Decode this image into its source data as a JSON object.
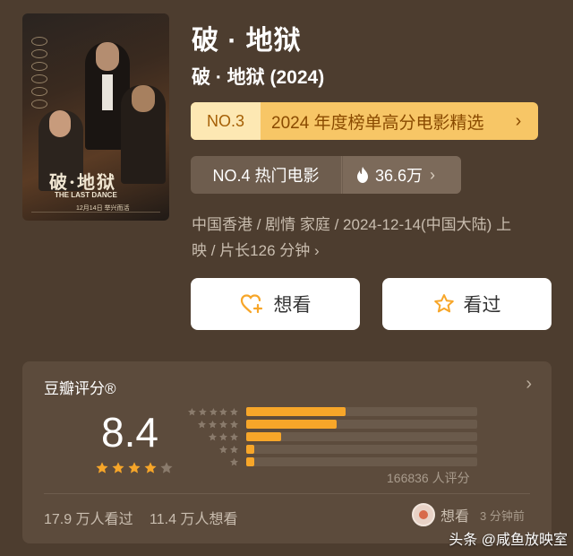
{
  "movie": {
    "title": "破 · 地狱",
    "subtitle": "破 · 地狱 (2024)"
  },
  "poster": {
    "title_art": "破·地狱",
    "title_en": "THE LAST DANCE",
    "release_text": "12月14日 举兴而活"
  },
  "ranking": {
    "rank_no": "NO.3",
    "rank_label": "2024 年度榜单高分电影精选"
  },
  "hot": {
    "hot_label": "NO.4 热门电影",
    "heat_value": "36.6万"
  },
  "meta": {
    "line1": "中国香港 / 剧情 家庭 / 2024-12-14(中国大陆) 上",
    "line2": "映 / 片长126 分钟"
  },
  "actions": {
    "want_label": "想看",
    "seen_label": "看过"
  },
  "rating": {
    "header": "豆瓣评分®",
    "score": "8.4",
    "stars_filled": 4,
    "stars_total": 5,
    "distribution": [
      {
        "stars": 5,
        "fraction": 0.43
      },
      {
        "stars": 4,
        "fraction": 0.39
      },
      {
        "stars": 3,
        "fraction": 0.15
      },
      {
        "stars": 2,
        "fraction": 0.03
      },
      {
        "stars": 1,
        "fraction": 0.03
      }
    ],
    "count_text": "166836 人评分"
  },
  "stats": {
    "seen_text": "17.9 万人看过",
    "want_text": "11.4 万人想看"
  },
  "activity": {
    "action": "想看",
    "time": "3 分钟前"
  },
  "watermark": "头条 @咸鱼放映室",
  "colors": {
    "background": "#4d3d2f",
    "accent": "#f7c666",
    "star": "#f7a629"
  }
}
